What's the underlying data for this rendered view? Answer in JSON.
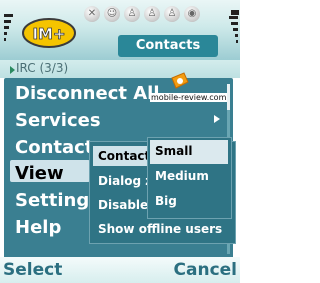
{
  "header": {
    "title": "Contacts",
    "logo_text": "IM+"
  },
  "background_row": {
    "text": "IRC (3/3)"
  },
  "menu": {
    "items": [
      "Disconnect All",
      "Services",
      "Contacts",
      "View",
      "Settings",
      "Help"
    ],
    "selected": "View"
  },
  "view_submenu": {
    "items": [
      "Contact",
      "Dialog z",
      "Disable",
      "Show offline users"
    ],
    "selected": "Contact"
  },
  "size_submenu": {
    "items": [
      "Small",
      "Medium",
      "Big"
    ],
    "selected": "Small"
  },
  "watermark": {
    "text": "mobile-review.com"
  },
  "softkeys": {
    "left": "Select",
    "right": "Cancel"
  },
  "colors": {
    "menu_bg": "#3a7f91",
    "highlight": "#cfe3ea",
    "softkey_text": "#2b6f80",
    "header_tab": "#2a8798"
  },
  "icons": [
    "signal-bars-icon",
    "battery-bars-icon",
    "im-plus-logo",
    "status-icons",
    "submenu-arrow-icon",
    "watermark-badge-icon"
  ]
}
